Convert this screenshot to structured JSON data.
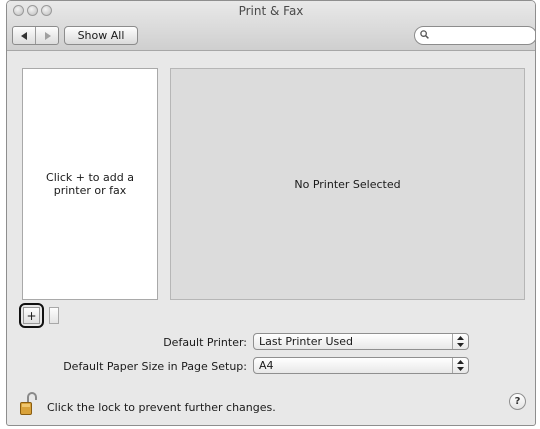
{
  "window": {
    "title": "Print & Fax"
  },
  "toolbar": {
    "back_icon": "triangle-left-icon",
    "forward_icon": "triangle-right-icon",
    "show_all_label": "Show All",
    "search_value": "",
    "search_placeholder": ""
  },
  "printer_list": {
    "empty_message": "Click + to add a printer or fax"
  },
  "detail": {
    "empty_message": "No Printer Selected"
  },
  "list_controls": {
    "add_label": "+",
    "remove_label": ""
  },
  "settings": {
    "default_printer": {
      "label": "Default Printer:",
      "value": "Last Printer Used"
    },
    "default_paper_size": {
      "label": "Default Paper Size in Page Setup:",
      "value": "A4"
    }
  },
  "footer": {
    "lock_message": "Click the lock to prevent further changes.",
    "help_label": "?"
  },
  "colors": {
    "window_bg": "#e8e8e8",
    "lock_gold": "#d9a23a"
  }
}
